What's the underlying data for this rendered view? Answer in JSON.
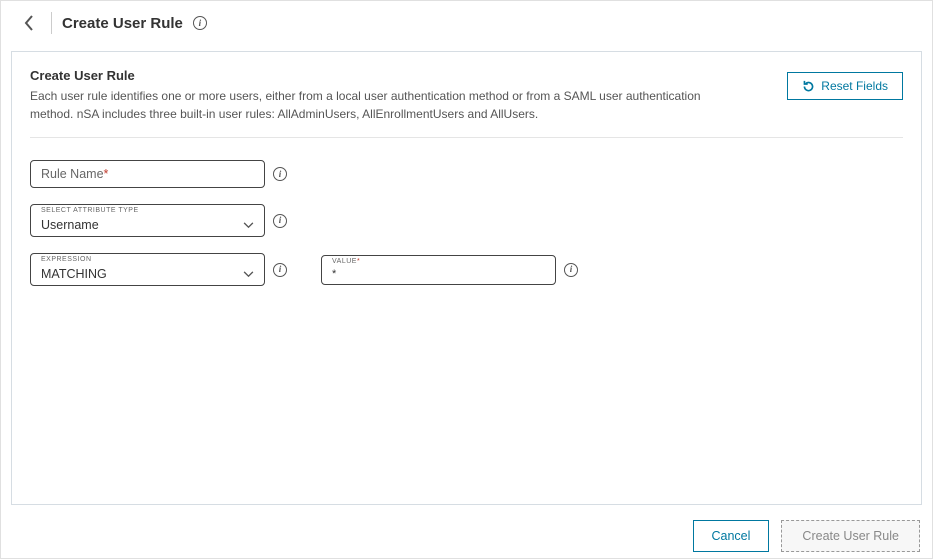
{
  "header": {
    "title": "Create User Rule"
  },
  "panel": {
    "title": "Create User Rule",
    "description": "Each user rule identifies one or more users, either from a local user authentication method or from a SAML user authentication method. nSA includes three built-in user rules: AllAdminUsers, AllEnrollmentUsers and AllUsers.",
    "reset_label": "Reset Fields"
  },
  "form": {
    "rule_name": {
      "placeholder": "Rule Name",
      "required_mark": "*"
    },
    "attribute_type": {
      "label": "SELECT ATTRIBUTE TYPE",
      "value": "Username"
    },
    "expression": {
      "label": "EXPRESSION",
      "value": "MATCHING"
    },
    "value_field": {
      "label": "VALUE",
      "required_mark": "*",
      "value": "*"
    }
  },
  "footer": {
    "cancel": "Cancel",
    "create": "Create User Rule"
  }
}
